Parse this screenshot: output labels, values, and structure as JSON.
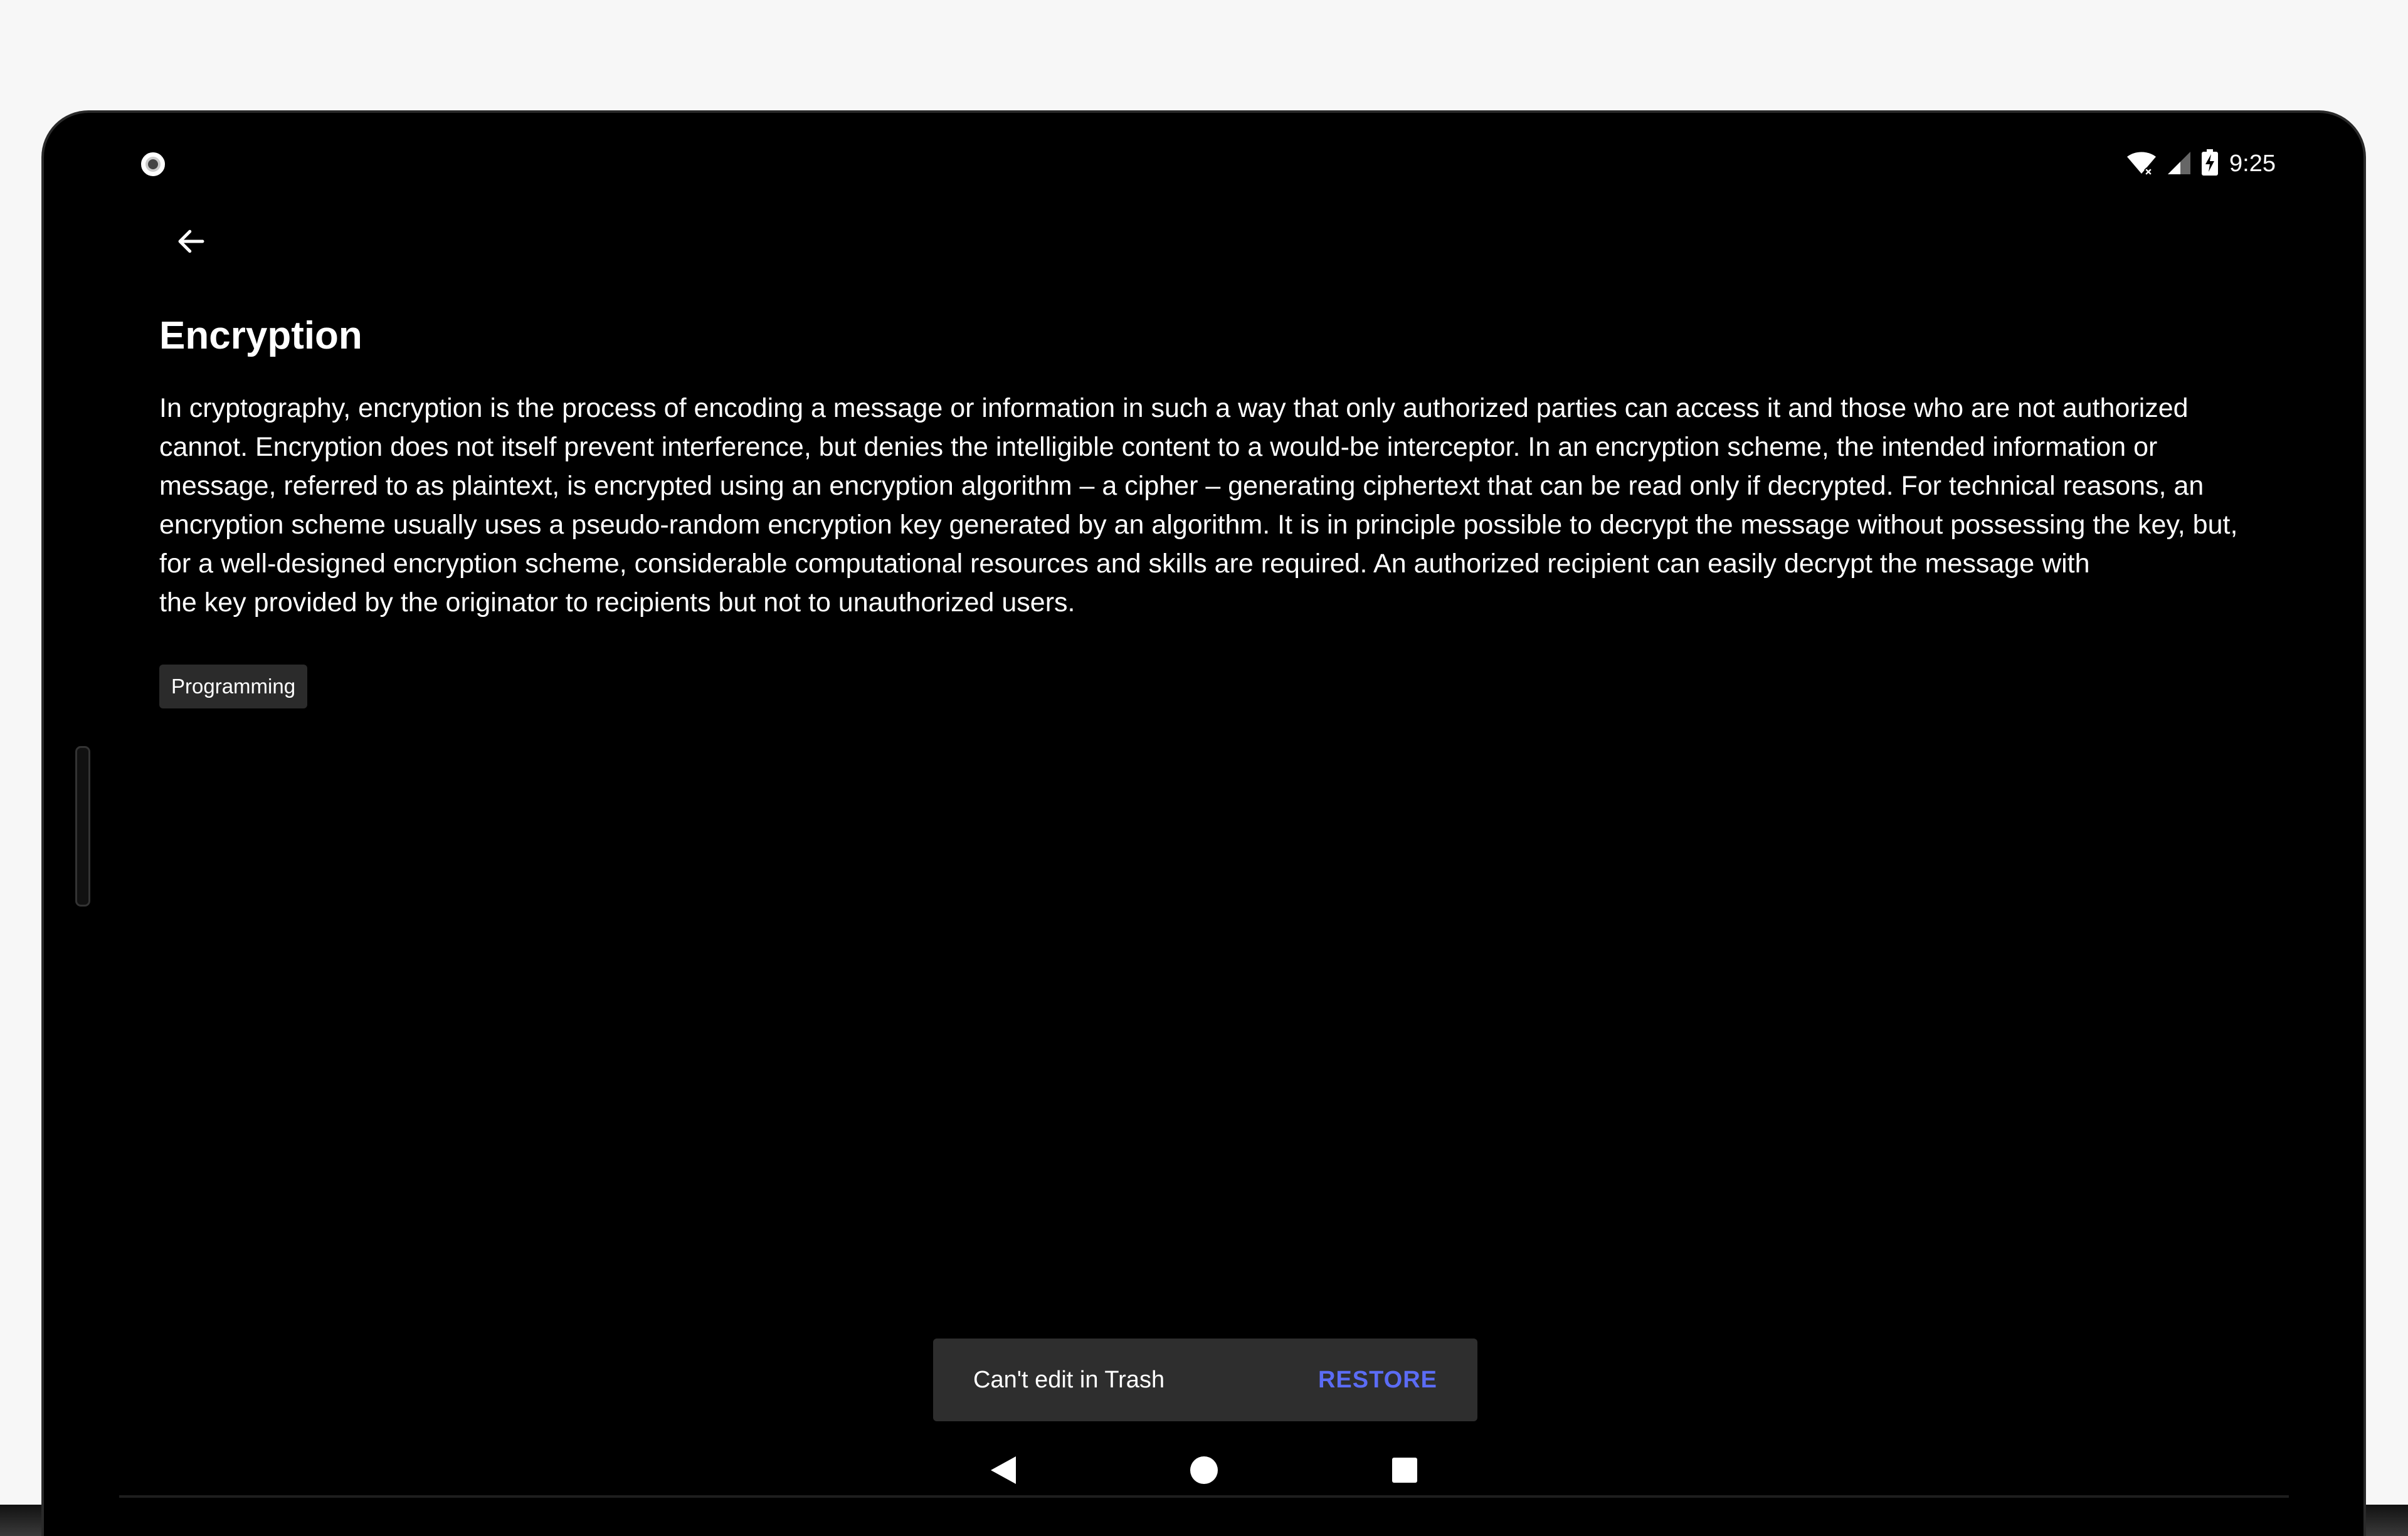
{
  "status_bar": {
    "time": "9:25",
    "icons": [
      "wifi-icon",
      "cell-signal-icon",
      "battery-charging-icon"
    ]
  },
  "toolbar": {
    "back_icon": "arrow-left-icon"
  },
  "note": {
    "title": "Encryption",
    "body": "In cryptography, encryption is the process of encoding a message or information in such a way that only authorized parties can access it and those who are not authorized\ncannot. Encryption does not itself prevent interference, but denies the intelligible content to a would-be interceptor. In an encryption scheme, the intended information or\nmessage, referred to as plaintext, is encrypted using an encryption algorithm – a cipher – generating ciphertext that can be read only if decrypted. For technical reasons, an\nencryption scheme usually uses a pseudo-random encryption key generated by an algorithm. It is in principle possible to decrypt the message without possessing the key, but,\nfor a well-designed encryption scheme, considerable computational resources and skills are required. An authorized recipient can easily decrypt the message with\nthe key provided by the originator to recipients but not to unauthorized users.",
    "tags": [
      "Programming"
    ]
  },
  "snackbar": {
    "message": "Can't edit in Trash",
    "action": "RESTORE",
    "action_color": "#5b6cf5"
  },
  "nav_bar": {
    "keys": [
      "back-triangle-icon",
      "home-circle-icon",
      "recents-square-icon"
    ]
  }
}
